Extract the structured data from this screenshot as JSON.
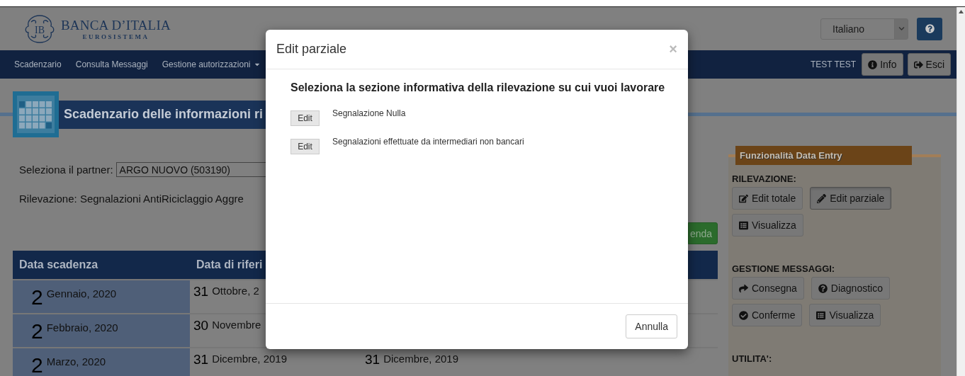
{
  "header": {
    "logo_monogram": "IB",
    "logo_title": "BANCA D’ITALIA",
    "logo_subtitle": "EUROSISTEMA",
    "language": "Italiano"
  },
  "navbar": {
    "items": [
      {
        "label": "Scadenzario",
        "dropdown": false
      },
      {
        "label": "Consulta Messaggi",
        "dropdown": false
      },
      {
        "label": "Gestione autorizzazioni",
        "dropdown": true
      }
    ],
    "user": "TEST TEST",
    "buttons": [
      "Info",
      "Esci"
    ]
  },
  "page_title": "Scadenzario delle informazioni ri",
  "partner": {
    "label": "Seleziona il partner:",
    "value": "ARGO NUOVO (503190)"
  },
  "rilevazione": "Rilevazione: Segnalazioni AntiRiciclaggio Aggre",
  "green_button": "enda",
  "table": {
    "columns": [
      "Data scadenza",
      "Data di riferi"
    ],
    "rows": [
      {
        "scadenza": {
          "day": "2",
          "month": "Gennaio, 2020"
        },
        "riferimento": {
          "day": "31",
          "month": "Ottobre, 2"
        }
      },
      {
        "scadenza": {
          "day": "2",
          "month": "Febbraio, 2020"
        },
        "riferimento": {
          "day": "30",
          "month": "Novembre"
        }
      },
      {
        "scadenza": {
          "day": "2",
          "month": "Marzo, 2020"
        },
        "riferimento": {
          "day": "31",
          "month": "Dicembre, 2019"
        },
        "column_3": {
          "day": "31",
          "month": "Dicembre, 2019"
        }
      }
    ]
  },
  "panel": {
    "legend": "Funzionalità Data Entry",
    "sections": [
      {
        "title": "RILEVAZIONE:",
        "buttons": [
          {
            "label": "Edit totale",
            "selected": false
          },
          {
            "label": "Edit parziale",
            "selected": true
          },
          {
            "label": "Visualizza",
            "selected": false
          }
        ]
      },
      {
        "title": "GESTIONE MESSAGGI:",
        "buttons": [
          {
            "label": "Consegna",
            "selected": false
          },
          {
            "label": "Diagnostico",
            "selected": false
          },
          {
            "label": "Conferme",
            "selected": false
          },
          {
            "label": "Visualizza",
            "selected": false
          }
        ]
      },
      {
        "title": "UTILITA':"
      }
    ]
  },
  "modal": {
    "title": "Edit parziale",
    "heading": "Seleziona la sezione informativa della rilevazione su cui vuoi lavorare",
    "items": [
      {
        "button": "Edit",
        "label": "Segnalazione Nulla"
      },
      {
        "button": "Edit",
        "label": "Segnalazioni effettuate da intermediari non bancari"
      }
    ],
    "close": "×",
    "footer_button": "Annulla"
  }
}
